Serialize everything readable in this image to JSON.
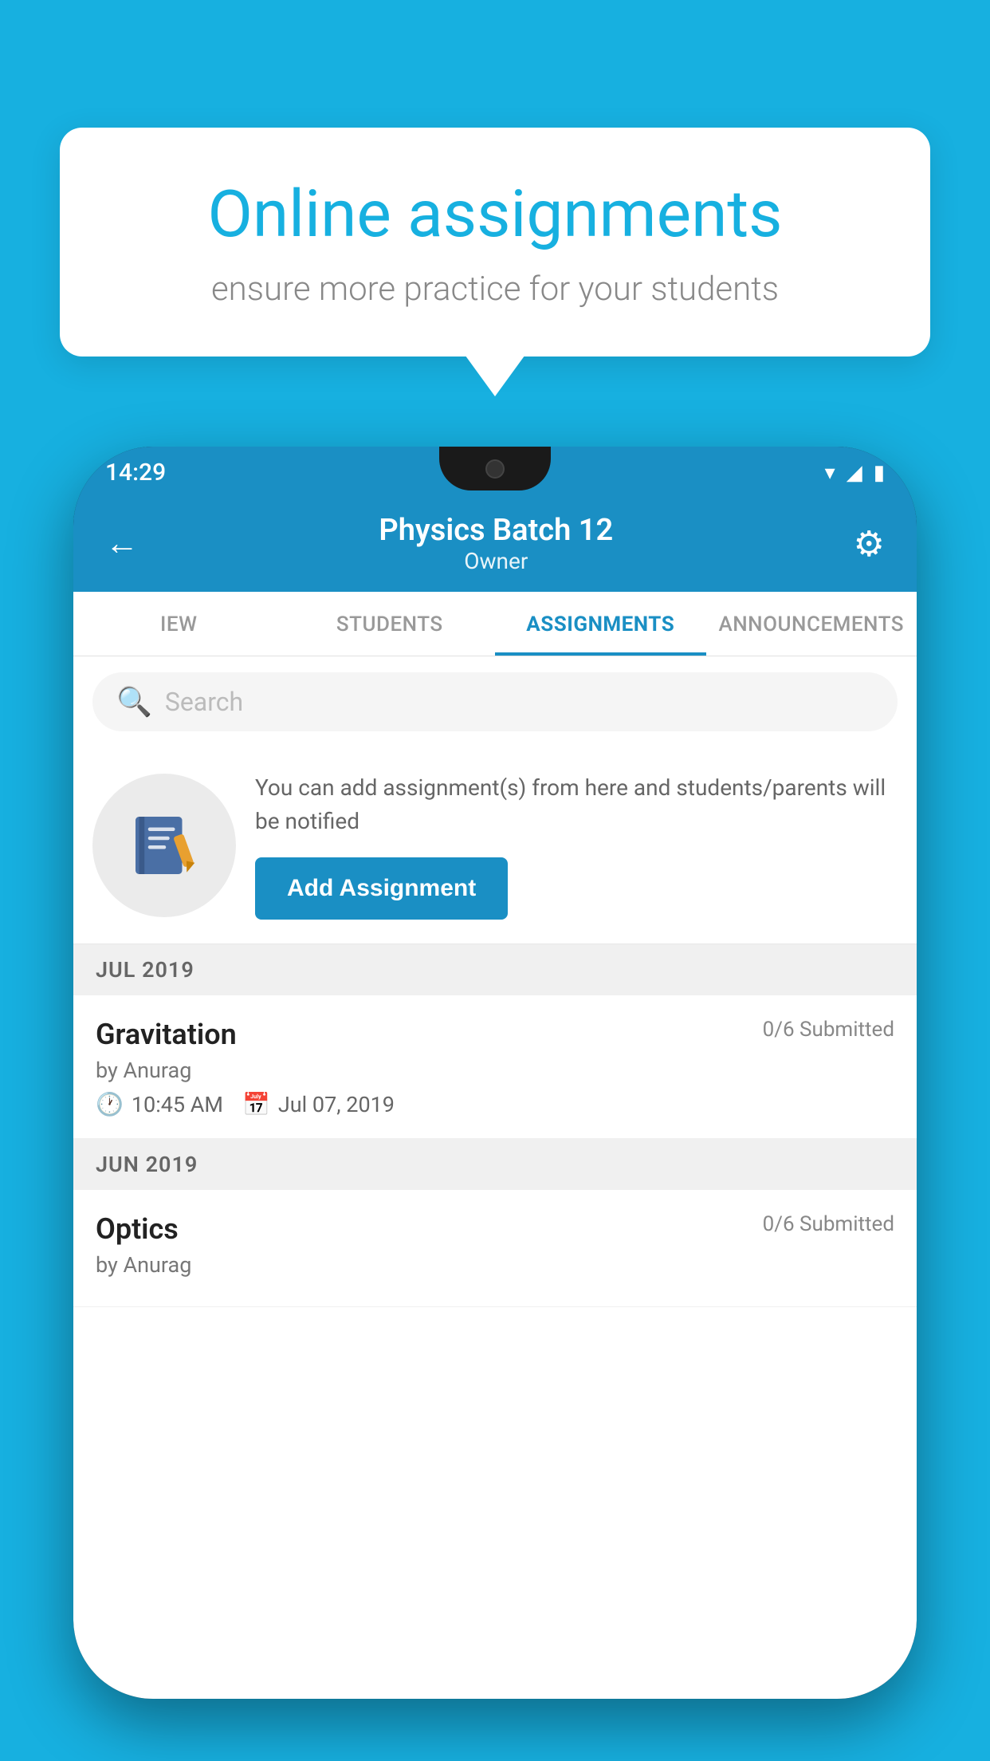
{
  "background_color": "#17b0e0",
  "bubble": {
    "title": "Online assignments",
    "subtitle": "ensure more practice for your students"
  },
  "phone": {
    "status_bar": {
      "time": "14:29",
      "icons": [
        "wifi",
        "signal",
        "battery"
      ]
    },
    "header": {
      "title": "Physics Batch 12",
      "subtitle": "Owner",
      "back_label": "←",
      "settings_label": "⚙"
    },
    "tabs": [
      {
        "label": "IEW",
        "active": false
      },
      {
        "label": "STUDENTS",
        "active": false
      },
      {
        "label": "ASSIGNMENTS",
        "active": true
      },
      {
        "label": "ANNOUNCEMENTS",
        "active": false
      }
    ],
    "search": {
      "placeholder": "Search"
    },
    "promo": {
      "text": "You can add assignment(s) from here and students/parents will be notified",
      "button_label": "Add Assignment"
    },
    "sections": [
      {
        "header": "JUL 2019",
        "assignments": [
          {
            "name": "Gravitation",
            "submitted": "0/6 Submitted",
            "by": "by Anurag",
            "time": "10:45 AM",
            "date": "Jul 07, 2019"
          }
        ]
      },
      {
        "header": "JUN 2019",
        "assignments": [
          {
            "name": "Optics",
            "submitted": "0/6 Submitted",
            "by": "by Anurag",
            "time": "",
            "date": ""
          }
        ]
      }
    ]
  }
}
